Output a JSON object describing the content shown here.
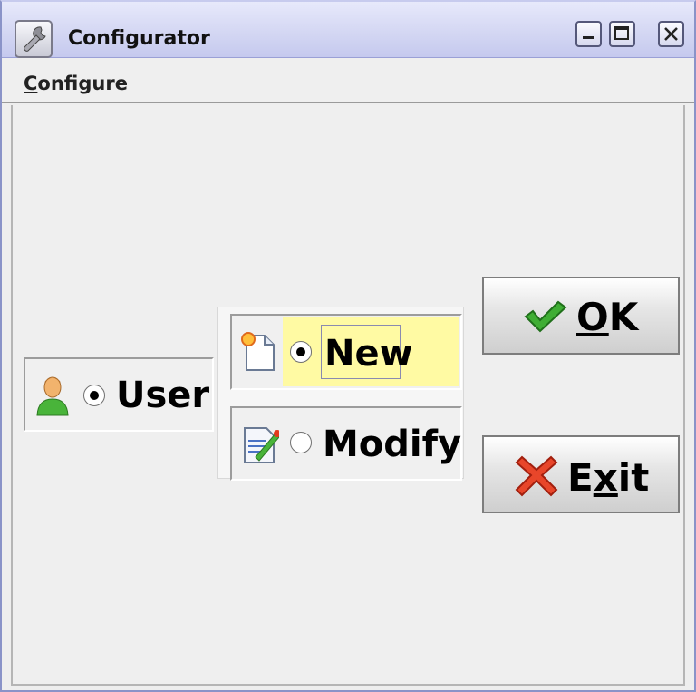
{
  "window": {
    "title": "Configurator",
    "icons": {
      "app": "wrench-icon",
      "minimize": "minimize-icon",
      "maximize": "maximize-icon",
      "close": "close-icon"
    }
  },
  "menubar": {
    "items": [
      {
        "mnemonic": "C",
        "rest": "onfigure"
      }
    ]
  },
  "user_group": {
    "icon": "user-icon",
    "label": "User",
    "selected": true
  },
  "mode_group": {
    "options": [
      {
        "icon": "new-document-icon",
        "label": "New",
        "selected": true,
        "highlight_color": "#fffaa3"
      },
      {
        "icon": "edit-document-icon",
        "label": "Modify",
        "selected": false
      }
    ]
  },
  "buttons": {
    "ok": {
      "icon": "checkmark-icon",
      "mnemonic": "O",
      "rest": "K",
      "accent": "#2e9a2e"
    },
    "exit": {
      "icon": "x-mark-icon",
      "prefix": "E",
      "mnemonic": "x",
      "rest": "it",
      "accent": "#e23a1c"
    }
  }
}
